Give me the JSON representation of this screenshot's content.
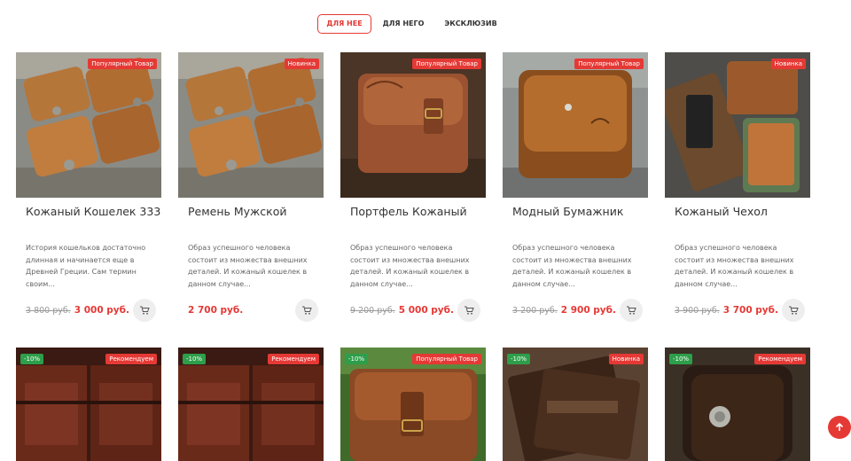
{
  "tabs": [
    {
      "label": "ДЛЯ НЕЕ",
      "active": true
    },
    {
      "label": "ДЛЯ НЕГО",
      "active": false
    },
    {
      "label": "ЭКСКЛЮЗИВ",
      "active": false
    }
  ],
  "products": [
    {
      "title": "Кожаный Кошелек 333",
      "description": "История кошельков достаточно длинная и начинается еще в Древней Греции. Сам термин своим...",
      "old_price": "3 800 руб.",
      "price": "3 000 руб.",
      "badges": {
        "top_right": "Популярный Товар"
      }
    },
    {
      "title": "Ремень Мужской",
      "description": "Образ успешного человека состоит из множества внешних деталей. И кожаный кошелек в данном случае...",
      "old_price": "",
      "price": "2 700 руб.",
      "badges": {
        "top_right": "Новинка"
      }
    },
    {
      "title": "Портфель Кожаный",
      "description": "Образ успешного человека состоит из множества внешних деталей. И кожаный кошелек в данном случае...",
      "old_price": "9 200 руб.",
      "price": "5 000 руб.",
      "badges": {
        "top_right": "Популярный Товар"
      }
    },
    {
      "title": "Модный Бумажник",
      "description": "Образ успешного человека состоит из множества внешних деталей. И кожаный кошелек в данном случае...",
      "old_price": "3 200 руб.",
      "price": "2 900 руб.",
      "badges": {
        "top_right": "Популярный Товар"
      }
    },
    {
      "title": "Кожаный Чехол",
      "description": "Образ успешного человека состоит из множества внешних деталей. И кожаный кошелек в данном случае...",
      "old_price": "3 900 руб.",
      "price": "3 700 руб.",
      "badges": {
        "top_right": "Новинка"
      }
    },
    {
      "badges": {
        "top_left": "-10%",
        "top_right": "Рекомендуем"
      }
    },
    {
      "badges": {
        "top_left": "-10%",
        "top_right": "Рекомендуем"
      }
    },
    {
      "badges": {
        "top_left": "-10%",
        "top_right": "Популярный Товар"
      }
    },
    {
      "badges": {
        "top_left": "-10%",
        "top_right": "Новинка"
      }
    },
    {
      "badges": {
        "top_left": "-10%",
        "top_right": "Рекомендуем"
      }
    }
  ],
  "icons": {
    "cart": "cart-icon",
    "scroll_top": "arrow-up-icon"
  },
  "colors": {
    "accent": "#e53935",
    "discount_badge": "#2e9e4a",
    "old_price": "#9a9a9a"
  }
}
